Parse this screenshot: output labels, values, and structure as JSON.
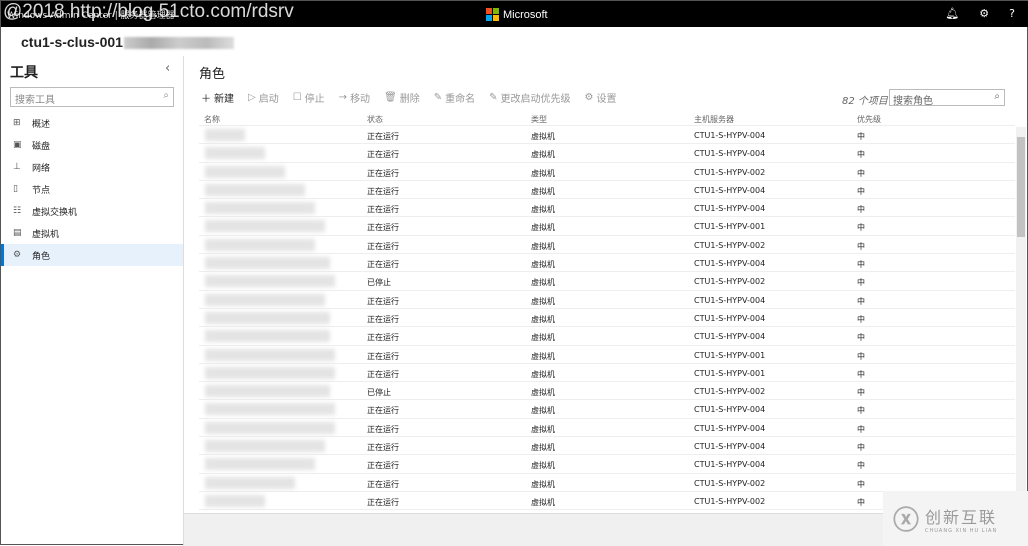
{
  "titlebar": {
    "app": "Windows Admin Center | 服务器管理器",
    "brand": "Microsoft",
    "watermark": "@2018 http://blog.51cto.com/rdsrv"
  },
  "server": "ctu1-s-clus-001",
  "sidebar": {
    "title": "工具",
    "search_placeholder": "搜索工具",
    "items": [
      {
        "label": "概述",
        "icon": "overview-icon"
      },
      {
        "label": "磁盘",
        "icon": "disk-icon"
      },
      {
        "label": "网络",
        "icon": "network-icon"
      },
      {
        "label": "节点",
        "icon": "node-icon"
      },
      {
        "label": "虚拟交换机",
        "icon": "switch-icon"
      },
      {
        "label": "虚拟机",
        "icon": "vm-icon"
      },
      {
        "label": "角色",
        "icon": "gear-icon",
        "active": true
      }
    ]
  },
  "main": {
    "title": "角色",
    "toolbar": [
      "新建",
      "启动",
      "停止",
      "移动",
      "删除",
      "重命名",
      "更改启动优先级",
      "设置"
    ],
    "count": "82 个项目",
    "search_placeholder": "搜索角色",
    "columns": [
      "名称",
      "状态",
      "类型",
      "主机服务器",
      "优先级"
    ],
    "rows": [
      [
        "正在运行",
        "虚拟机",
        "CTU1-S-HYPV-004",
        "中"
      ],
      [
        "正在运行",
        "虚拟机",
        "CTU1-S-HYPV-004",
        "中"
      ],
      [
        "正在运行",
        "虚拟机",
        "CTU1-S-HYPV-002",
        "中"
      ],
      [
        "正在运行",
        "虚拟机",
        "CTU1-S-HYPV-004",
        "中"
      ],
      [
        "正在运行",
        "虚拟机",
        "CTU1-S-HYPV-004",
        "中"
      ],
      [
        "正在运行",
        "虚拟机",
        "CTU1-S-HYPV-001",
        "中"
      ],
      [
        "正在运行",
        "虚拟机",
        "CTU1-S-HYPV-002",
        "中"
      ],
      [
        "正在运行",
        "虚拟机",
        "CTU1-S-HYPV-004",
        "中"
      ],
      [
        "已停止",
        "虚拟机",
        "CTU1-S-HYPV-002",
        "中"
      ],
      [
        "正在运行",
        "虚拟机",
        "CTU1-S-HYPV-004",
        "中"
      ],
      [
        "正在运行",
        "虚拟机",
        "CTU1-S-HYPV-004",
        "中"
      ],
      [
        "正在运行",
        "虚拟机",
        "CTU1-S-HYPV-004",
        "中"
      ],
      [
        "正在运行",
        "虚拟机",
        "CTU1-S-HYPV-001",
        "中"
      ],
      [
        "正在运行",
        "虚拟机",
        "CTU1-S-HYPV-001",
        "中"
      ],
      [
        "已停止",
        "虚拟机",
        "CTU1-S-HYPV-002",
        "中"
      ],
      [
        "正在运行",
        "虚拟机",
        "CTU1-S-HYPV-004",
        "中"
      ],
      [
        "正在运行",
        "虚拟机",
        "CTU1-S-HYPV-004",
        "中"
      ],
      [
        "正在运行",
        "虚拟机",
        "CTU1-S-HYPV-004",
        "中"
      ],
      [
        "正在运行",
        "虚拟机",
        "CTU1-S-HYPV-004",
        "中"
      ],
      [
        "正在运行",
        "虚拟机",
        "CTU1-S-HYPV-002",
        "中"
      ],
      [
        "正在运行",
        "虚拟机",
        "CTU1-S-HYPV-002",
        "中"
      ]
    ]
  },
  "logo": {
    "text": "创新互联",
    "sub": "CHUANG XIN HU LIAN"
  }
}
